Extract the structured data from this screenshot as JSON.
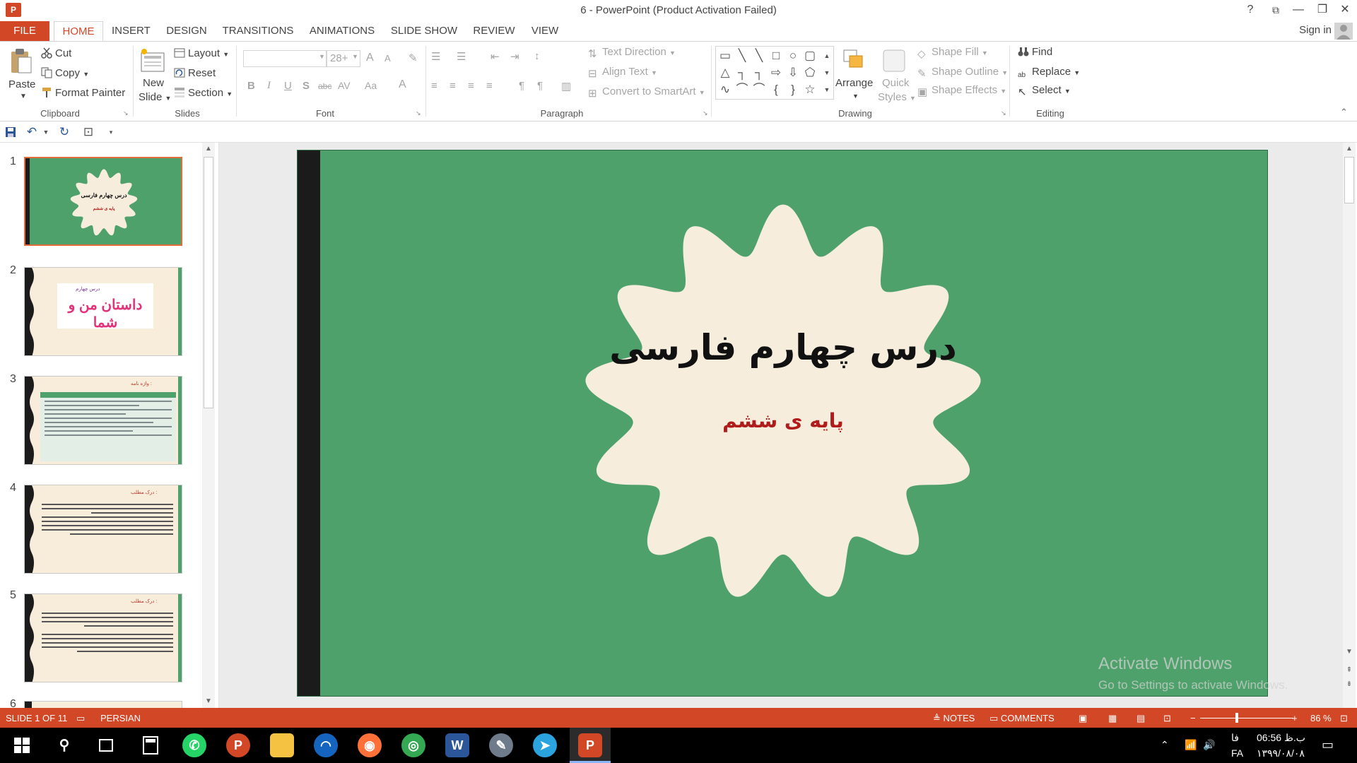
{
  "window": {
    "title": "6 - PowerPoint (Product Activation Failed)",
    "app_icon_letter": "P",
    "help": "?",
    "ribbon_display": "⧉",
    "minimize": "—",
    "restore": "❐",
    "close": "✕"
  },
  "tabs": {
    "file": "FILE",
    "home": "HOME",
    "insert": "INSERT",
    "design": "DESIGN",
    "transitions": "TRANSITIONS",
    "animations": "ANIMATIONS",
    "slideshow": "SLIDE SHOW",
    "review": "REVIEW",
    "view": "VIEW",
    "signin": "Sign in"
  },
  "ribbon": {
    "clipboard": {
      "paste": "Paste",
      "cut": "Cut",
      "copy": "Copy",
      "format_painter": "Format Painter",
      "label": "Clipboard"
    },
    "slides": {
      "new_slide_line1": "New",
      "new_slide_line2": "Slide",
      "layout": "Layout",
      "reset": "Reset",
      "section": "Section",
      "label": "Slides"
    },
    "font": {
      "font_name": "",
      "font_size": "28+",
      "grow": "A",
      "shrink": "A",
      "bold": "B",
      "italic": "I",
      "underline": "U",
      "shadow": "S",
      "strike": "abc",
      "spacing": "AV",
      "case": "Aa",
      "color": "A",
      "label": "Font"
    },
    "paragraph": {
      "text_direction": "Text Direction",
      "align_text": "Align Text",
      "convert_smartart": "Convert to SmartArt",
      "label": "Paragraph"
    },
    "drawing": {
      "arrange": "Arrange",
      "quick_styles_line1": "Quick",
      "quick_styles_line2": "Styles",
      "shape_fill": "Shape Fill",
      "shape_outline": "Shape Outline",
      "shape_effects": "Shape Effects",
      "label": "Drawing"
    },
    "editing": {
      "find": "Find",
      "replace": "Replace",
      "select": "Select",
      "label": "Editing"
    }
  },
  "thumbnails": {
    "numbers": [
      "1",
      "2",
      "3",
      "4",
      "5",
      "6"
    ],
    "slide1_title": "درس چهارم فارسی",
    "slide1_subtitle": "پایه ی ششم",
    "slide2_small": "درس چهارم",
    "slide2_title": "داستان من و شما",
    "slide3_heading": "واژه نامه :",
    "slide4_heading": "درک مطلب :",
    "slide5_heading": "درک مطلب :"
  },
  "slide": {
    "title": "درس چهارم فارسی",
    "subtitle": "پایه ی ششم"
  },
  "watermark": {
    "title": "Activate Windows",
    "subtitle": "Go to Settings to activate Windows."
  },
  "statusbar": {
    "slide_info": "SLIDE 1 OF 11",
    "language": "PERSIAN",
    "notes": "NOTES",
    "comments": "COMMENTS",
    "zoom": "86 %"
  },
  "taskbar": {
    "lang": "فا",
    "lang2": "FA",
    "time": "06:56 ب.ظ",
    "date": "۱۳۹۹/۰۸/۰۸"
  },
  "colors": {
    "accent": "#d24726",
    "slide_bg": "#4fa16c",
    "badge_fill": "#f6eddc",
    "subtitle": "#b01c1c"
  }
}
